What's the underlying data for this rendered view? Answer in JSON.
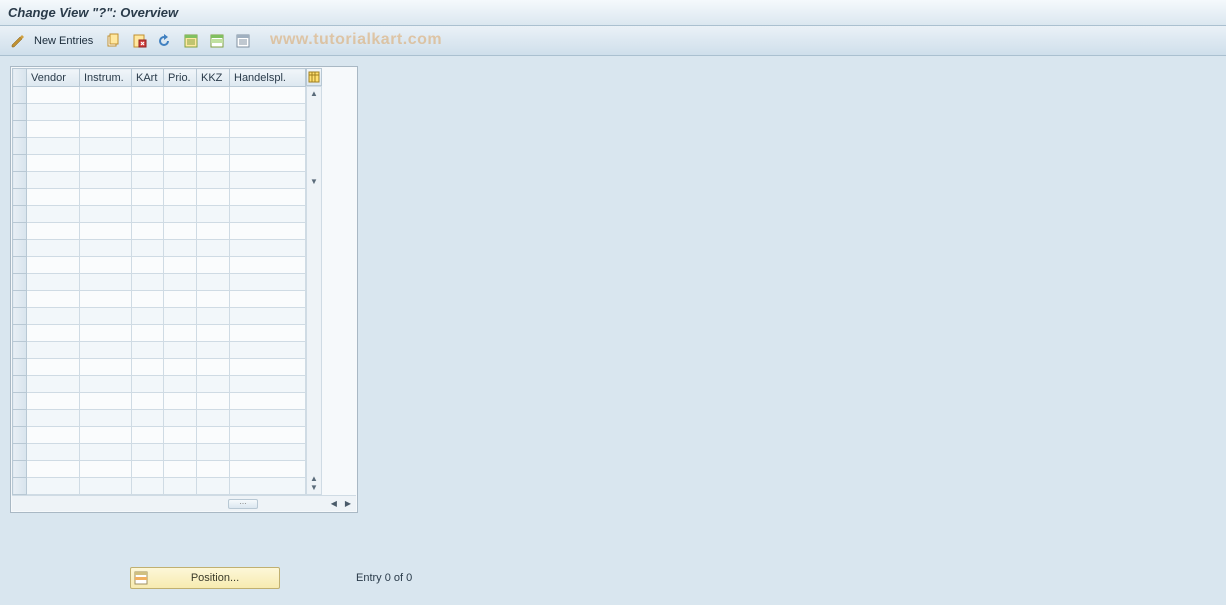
{
  "title": "Change View \"?\": Overview",
  "toolbar": {
    "new_entries_label": "New Entries",
    "icons": {
      "edit": "edit-icon",
      "copy": "copy-icon",
      "delete": "delete-icon",
      "undo": "undo-icon",
      "select_all": "select-all-icon",
      "select_block": "select-block-icon",
      "deselect": "deselect-icon"
    }
  },
  "watermark": "www.tutorialkart.com",
  "table": {
    "columns": [
      "Vendor",
      "Instrum.",
      "KArt",
      "Prio.",
      "KKZ",
      "Handelspl."
    ],
    "row_count": 24,
    "config_label": "⊞"
  },
  "footer": {
    "position_label": "Position...",
    "entry_text": "Entry 0 of 0"
  }
}
